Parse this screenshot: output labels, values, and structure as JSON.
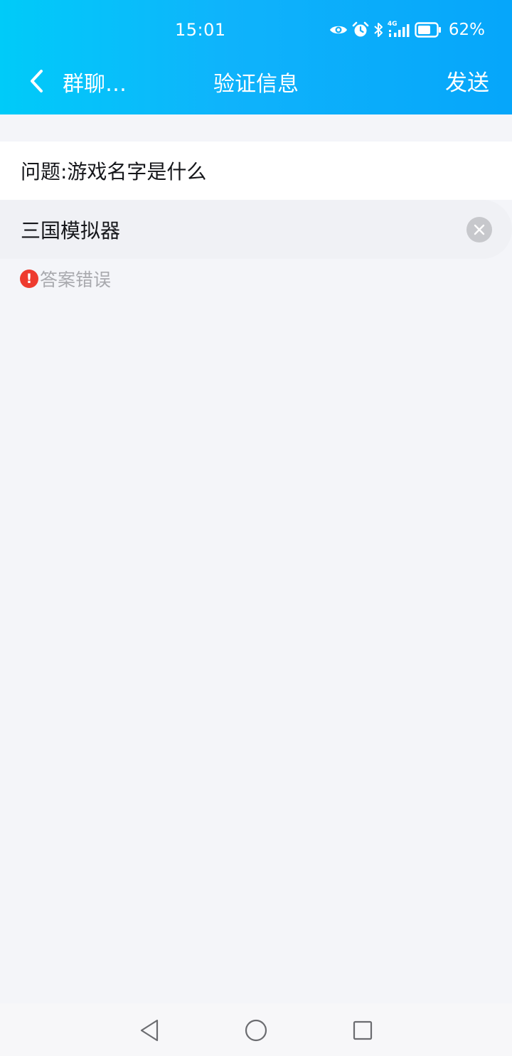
{
  "status_bar": {
    "time": "15:01",
    "network": "4G",
    "battery_percent": "62%",
    "icons": [
      "eye-icon",
      "alarm-icon",
      "bluetooth-icon",
      "signal-icon",
      "battery-icon"
    ]
  },
  "nav": {
    "back_label": "群聊…",
    "title": "验证信息",
    "send_label": "发送"
  },
  "form": {
    "question": "问题:游戏名字是什么",
    "answer": "三国模拟器",
    "error_message": "答案错误"
  },
  "colors": {
    "header_gradient_start": "#00cbf9",
    "header_gradient_end": "#06a6fa",
    "error_red": "#ee3b2f",
    "page_background": "#f4f5f9"
  }
}
